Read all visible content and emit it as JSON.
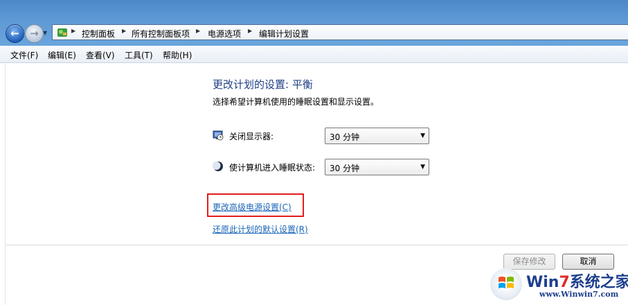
{
  "address_bar": {
    "breadcrumbs": [
      "控制面板",
      "所有控制面板项",
      "电源选项",
      "编辑计划设置"
    ]
  },
  "menu": [
    "文件(F)",
    "编辑(E)",
    "查看(V)",
    "工具(T)",
    "帮助(H)"
  ],
  "main": {
    "title": "更改计划的设置: 平衡",
    "subtitle": "选择希望计算机使用的睡眠设置和显示设置。",
    "display_off": {
      "label": "关闭显示器:",
      "value": "30 分钟"
    },
    "sleep": {
      "label": "使计算机进入睡眠状态:",
      "value": "30 分钟"
    },
    "advanced_link": "更改高级电源设置(C)",
    "restore_link": "还原此计划的默认设置(R)"
  },
  "buttons": {
    "save": "保存修改",
    "cancel": "取消"
  },
  "watermark": {
    "brand": "Win7系统之家",
    "url": "www.Winwin7.com"
  },
  "colors": {
    "link": "#1a66b8",
    "title": "#1e3f84",
    "highlight": "#e11d1d",
    "aero_blue": "#5d98d4"
  }
}
